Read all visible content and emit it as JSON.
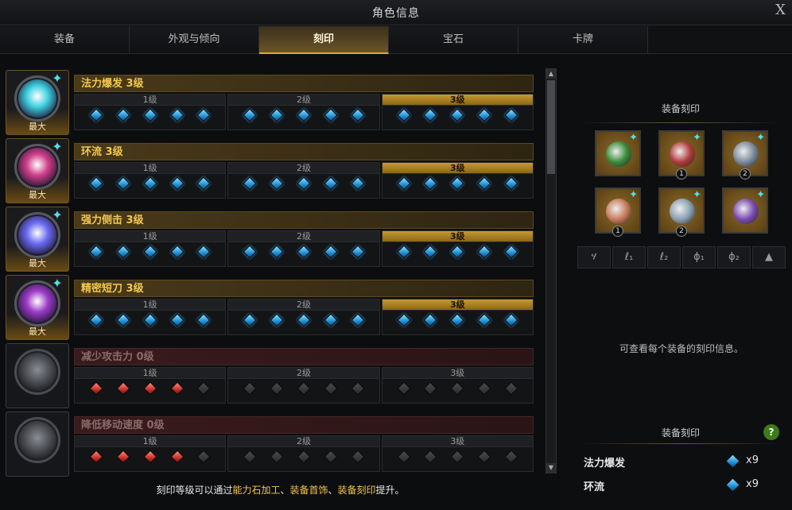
{
  "window": {
    "title": "角色信息",
    "close": "X"
  },
  "tabs": [
    {
      "label": "装备",
      "active": false
    },
    {
      "label": "外观与倾向",
      "active": false
    },
    {
      "label": "刻印",
      "active": true
    },
    {
      "label": "宝石",
      "active": false
    },
    {
      "label": "卡牌",
      "active": false
    }
  ],
  "engravings": [
    {
      "name": "法力爆发 3级",
      "type": "positive",
      "max_label": "最大",
      "active_level": 3,
      "orb": "orb-frost-icon",
      "orb_color": "#3fd0e0"
    },
    {
      "name": "环流 3级",
      "type": "positive",
      "max_label": "最大",
      "active_level": 3,
      "orb": "orb-flow-icon",
      "orb_color": "#d0408a"
    },
    {
      "name": "强力侧击 3级",
      "type": "positive",
      "max_label": "最大",
      "active_level": 3,
      "orb": "orb-strike-icon",
      "orb_color": "#6a6cf0"
    },
    {
      "name": "精密短刀 3级",
      "type": "positive",
      "max_label": "最大",
      "active_level": 3,
      "orb": "orb-dagger-icon",
      "orb_color": "#9c3cc8"
    },
    {
      "name": "减少攻击力 0级",
      "type": "negative",
      "max_label": "",
      "active_level": 0,
      "filled": 4,
      "orb": "orb-attack-down-icon"
    },
    {
      "name": "降低移动速度 0级",
      "type": "negative",
      "max_label": "",
      "active_level": 0,
      "filled": 4,
      "orb": "orb-speed-down-icon"
    }
  ],
  "level_labels": [
    "1级",
    "2级",
    "3级"
  ],
  "footer": {
    "prefix": "刻印等级可以通过",
    "link1": "能力石加工",
    "sep1": "、",
    "link2": "装备首饰",
    "sep2": "、",
    "link3": "装备刻印",
    "suffix": "提升。"
  },
  "equip_panel": {
    "title": "装备刻印",
    "items": [
      {
        "icon": "necklace-icon",
        "num": "",
        "color": "#3a8a3a"
      },
      {
        "icon": "earring-icon",
        "num": "1",
        "color": "#b03a3a"
      },
      {
        "icon": "earring-icon",
        "num": "2",
        "color": "#7a8a9a"
      },
      {
        "icon": "ring-icon",
        "num": "1",
        "color": "#c87a5a"
      },
      {
        "icon": "ring-icon",
        "num": "2",
        "color": "#8aa0b0"
      },
      {
        "icon": "stone-icon",
        "num": "",
        "color": "#7a4ab0"
      }
    ],
    "slots": [
      "necklace-slot-icon",
      "earring1-slot-icon",
      "earring2-slot-icon",
      "ring1-slot-icon",
      "ring2-slot-icon",
      "stone-slot-icon"
    ],
    "slot_glyphs": [
      "ሃ",
      "ℓ₁",
      "ℓ₂",
      "ϕ₁",
      "ϕ₂",
      "▲"
    ],
    "info": "可查看每个装备的刻印信息。"
  },
  "summary": {
    "title": "装备刻印",
    "help": "?",
    "rows": [
      {
        "name": "法力爆发",
        "count": "x9"
      },
      {
        "name": "环流",
        "count": "x9"
      }
    ]
  }
}
